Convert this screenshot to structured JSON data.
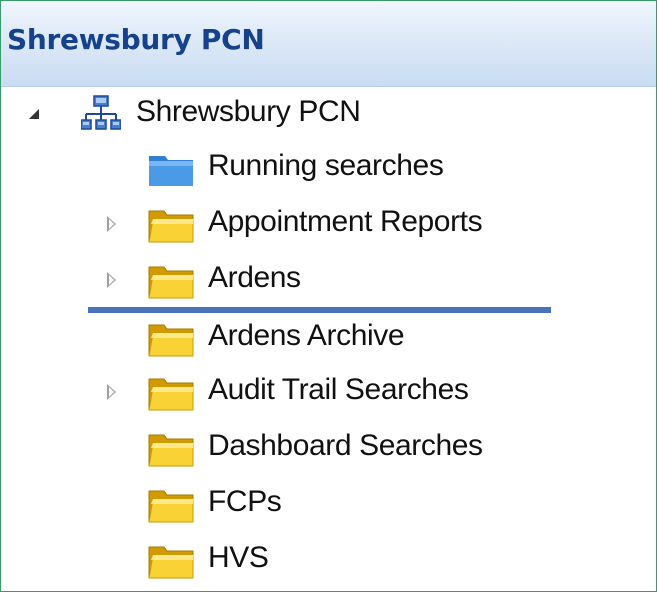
{
  "header": {
    "title": "Shrewsbury PCN"
  },
  "tree": {
    "root": {
      "label": "Shrewsbury PCN",
      "expanded": true,
      "icon": "organisation-network-icon"
    },
    "items": [
      {
        "label": "Running searches",
        "icon": "blue-folder-icon",
        "expandable": false
      },
      {
        "label": "Appointment Reports",
        "icon": "yellow-folder-icon",
        "expandable": true
      },
      {
        "label": "Ardens",
        "icon": "yellow-folder-icon",
        "expandable": true
      },
      {
        "label": "Ardens Archive",
        "icon": "yellow-folder-icon",
        "expandable": false
      },
      {
        "label": "Audit Trail Searches",
        "icon": "yellow-folder-icon",
        "expandable": true
      },
      {
        "label": "Dashboard Searches",
        "icon": "yellow-folder-icon",
        "expandable": false
      },
      {
        "label": "FCPs",
        "icon": "yellow-folder-icon",
        "expandable": false
      },
      {
        "label": "HVS",
        "icon": "yellow-folder-icon",
        "expandable": false
      }
    ]
  },
  "colors": {
    "header_text": "#15428b",
    "drop_indicator": "#4a72b8",
    "folder_yellow": "#f7c81e",
    "folder_blue": "#3d8fe0",
    "frame_border": "#3a9a6a"
  }
}
